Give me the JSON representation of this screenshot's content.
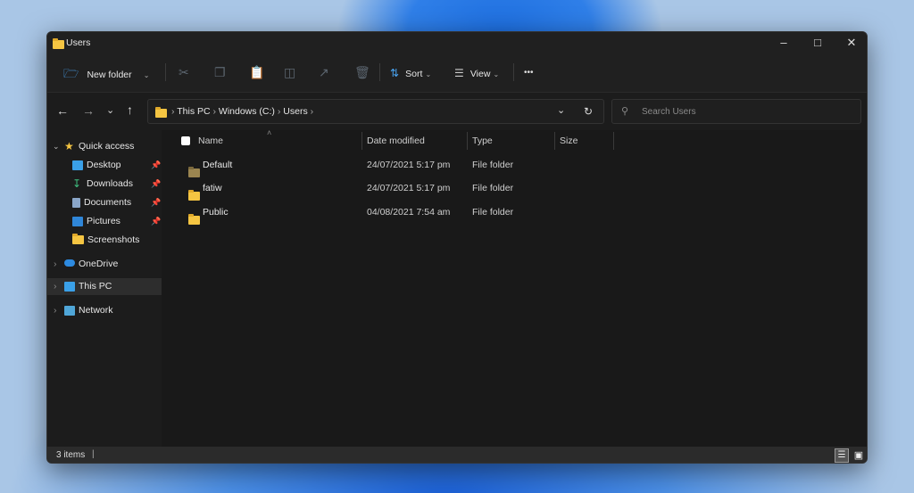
{
  "window": {
    "title": "Users"
  },
  "toolbar": {
    "new_folder": "New folder",
    "sort": "Sort",
    "view": "View",
    "more": "•••"
  },
  "address": {
    "crumbs": [
      "This PC",
      "Windows (C:)",
      "Users"
    ],
    "search_placeholder": "Search Users"
  },
  "sidebar": {
    "quick_access": "Quick access",
    "pinned": [
      {
        "label": "Desktop",
        "color": "#3aa0e8"
      },
      {
        "label": "Downloads",
        "color": "#3fbf7f"
      },
      {
        "label": "Documents",
        "color": "#8aa6c8"
      },
      {
        "label": "Pictures",
        "color": "#2f86d8"
      },
      {
        "label": "Screenshots",
        "color": "#f5c542"
      }
    ],
    "onedrive": "OneDrive",
    "this_pc": "This PC",
    "network": "Network"
  },
  "columns": {
    "name": "Name",
    "date": "Date modified",
    "type": "Type",
    "size": "Size"
  },
  "files": [
    {
      "name": "Default",
      "date": "24/07/2021 5:17 pm",
      "type": "File folder"
    },
    {
      "name": "fatiw",
      "date": "24/07/2021 5:17 pm",
      "type": "File folder"
    },
    {
      "name": "Public",
      "date": "04/08/2021 7:54 am",
      "type": "File folder"
    }
  ],
  "status": {
    "count": "3 items"
  }
}
